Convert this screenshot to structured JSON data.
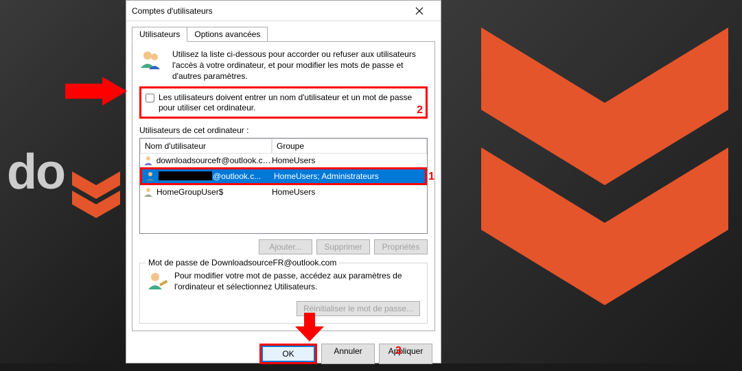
{
  "dialog": {
    "title": "Comptes d'utilisateurs",
    "tabs": {
      "users": "Utilisateurs",
      "advanced": "Options avancées"
    },
    "intro_text": "Utilisez la liste ci-dessous pour accorder ou refuser aux utilisateurs l'accès à votre ordinateur, et pour modifier les mots de passe et d'autres paramètres.",
    "checkbox_label": "Les utilisateurs doivent entrer un nom d'utilisateur et un mot de passe pour utiliser cet ordinateur.",
    "list_heading": "Utilisateurs de cet ordinateur :",
    "columns": {
      "username": "Nom d'utilisateur",
      "group": "Groupe"
    },
    "users": [
      {
        "name": "downloadsourcefr@outlook.co...",
        "group": "HomeUsers"
      },
      {
        "name_suffix": "@outlook.c...",
        "group": "HomeUsers; Administrateurs"
      },
      {
        "name": "HomeGroupUser$",
        "group": "HomeUsers"
      }
    ],
    "buttons": {
      "add": "Ajouter...",
      "remove": "Supprimer",
      "properties": "Propriétés"
    },
    "password_group": {
      "legend": "Mot de passe de DownloadsourceFR@outlook.com",
      "text": "Pour modifier votre mot de passe, accédez aux paramètres de l'ordinateur et sélectionnez Utilisateurs.",
      "reset": "Réinitialiser le mot de passe..."
    },
    "footer": {
      "ok": "OK",
      "cancel": "Annuler",
      "apply": "Appliquer"
    }
  },
  "callouts": {
    "num1": "1",
    "num2": "2",
    "num3": "3"
  },
  "background": {
    "text": "do"
  }
}
